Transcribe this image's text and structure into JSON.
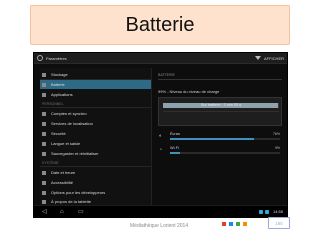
{
  "slide": {
    "title": "Batterie",
    "footer": "Médiathèque Lorient 2014",
    "page": "195",
    "footer_squares": [
      "#e53935",
      "#1e88e5",
      "#43a047",
      "#fb8c00"
    ]
  },
  "device": {
    "actionbar": {
      "title": "Paramètres",
      "more_label": "AFFICHER"
    },
    "sidebar": {
      "section_personal": "PERSONNEL",
      "section_system": "SYSTÈME",
      "items": [
        {
          "label": "Stockage",
          "icon": "storage-icon"
        },
        {
          "label": "Batterie",
          "icon": "battery-icon",
          "active": true
        },
        {
          "label": "Applications",
          "icon": "apps-icon"
        },
        {
          "label": "Comptes et synchro",
          "icon": "sync-icon"
        },
        {
          "label": "Services de localisation",
          "icon": "location-icon"
        },
        {
          "label": "Sécurité",
          "icon": "lock-icon"
        },
        {
          "label": "Langue et saisie",
          "icon": "language-icon"
        },
        {
          "label": "Sauvegarder et réinitialiser",
          "icon": "backup-icon"
        },
        {
          "label": "Date et heure",
          "icon": "clock-icon"
        },
        {
          "label": "Accessibilité",
          "icon": "accessibility-icon"
        },
        {
          "label": "Options pour les développeurs",
          "icon": "developer-icon"
        },
        {
          "label": "À propos de la tablette",
          "icon": "info-icon"
        }
      ]
    },
    "content": {
      "header": "BATTERIE",
      "status": "99% - Niveau du niveau de charge",
      "graph_label": "Sur batterie : 3 min 53 s",
      "graph_level": 0.99,
      "usage": [
        {
          "name": "Écran",
          "percent": "76%",
          "value": 0.76,
          "icon": "display-icon"
        },
        {
          "name": "Wi-Fi",
          "percent": "9%",
          "value": 0.09,
          "icon": "wifi-icon"
        }
      ]
    },
    "navbar": {
      "back": "◁",
      "home": "⌂",
      "recent": "▭",
      "clock": "14:55"
    }
  }
}
